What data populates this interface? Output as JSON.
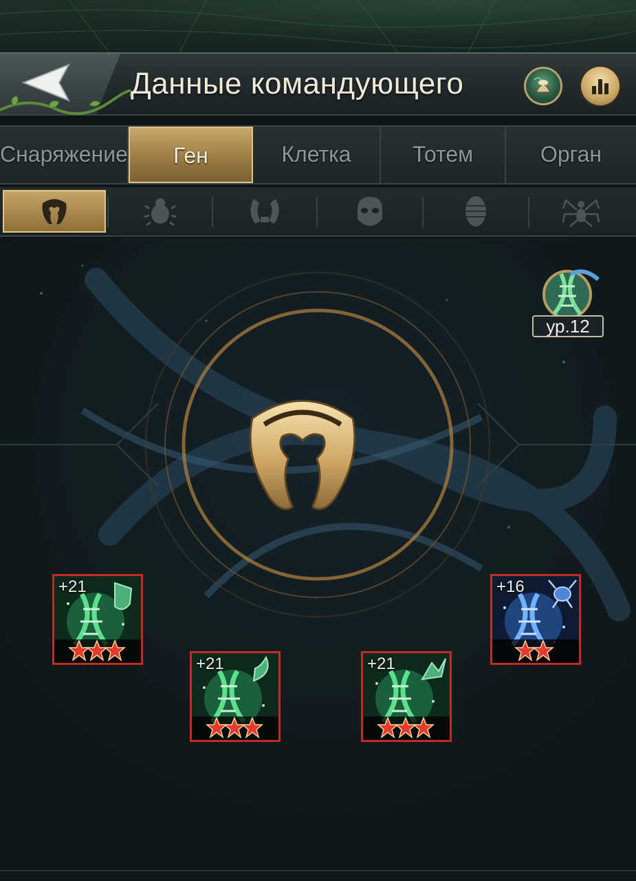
{
  "header": {
    "title": "Данные командующего",
    "back_icon": "arrow-left-icon",
    "totem_icon": "totem-tree-icon",
    "ranking_icon": "bar-chart-icon"
  },
  "tabs": [
    {
      "label": "Снаряжение",
      "active": false
    },
    {
      "label": "Ген",
      "active": true
    },
    {
      "label": "Клетка",
      "active": false
    },
    {
      "label": "Тотем",
      "active": false
    },
    {
      "label": "Орган",
      "active": false
    }
  ],
  "categories": [
    {
      "icon": "horn-emblem-icon",
      "active": true
    },
    {
      "icon": "beetle-icon",
      "active": false
    },
    {
      "icon": "mandible-icon",
      "active": false
    },
    {
      "icon": "skull-mask-icon",
      "active": false
    },
    {
      "icon": "larva-icon",
      "active": false
    },
    {
      "icon": "spider-icon",
      "active": false
    }
  ],
  "level_badge": {
    "label": "ур.12",
    "icon": "dna-helix-icon"
  },
  "center_emblem": {
    "icon": "horn-emblem-icon"
  },
  "genes": [
    {
      "bonus": "+21",
      "stars": 3,
      "color": "green",
      "symbol": "shield-icon"
    },
    {
      "bonus": "+21",
      "stars": 3,
      "color": "green",
      "symbol": "claw-icon"
    },
    {
      "bonus": "+21",
      "stars": 3,
      "color": "green",
      "symbol": "stinger-icon"
    },
    {
      "bonus": "+16",
      "stars": 2,
      "color": "blue",
      "symbol": "ant-icon"
    }
  ],
  "colors": {
    "accent_gold": "#c6a467",
    "gene_border": "#c42a26",
    "gene_green": "#3fc27a",
    "gene_blue": "#3f7fd6"
  }
}
